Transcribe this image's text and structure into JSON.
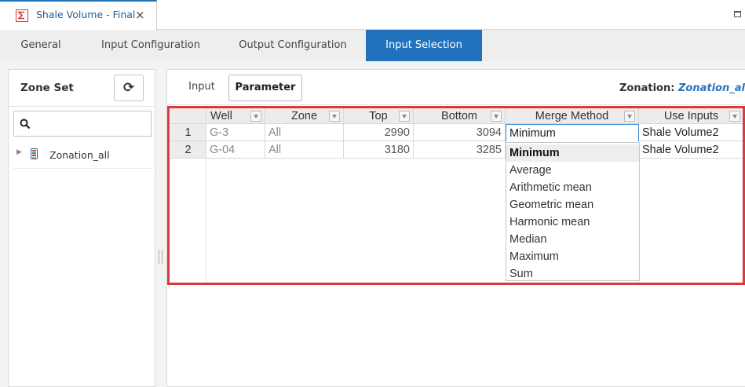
{
  "document_tab": {
    "title": "Shale Volume - Final",
    "close": "×"
  },
  "config_tabs": [
    "General",
    "Input Configuration",
    "Output Configuration",
    "Input Selection"
  ],
  "zone_set": {
    "title": "Zone Set",
    "refresh_glyph": "⟳",
    "search_value": "",
    "tree": [
      {
        "label": "Zonation_all"
      }
    ]
  },
  "inner_tabs": [
    "Input",
    "Parameter"
  ],
  "zonation": {
    "label": "Zonation:",
    "value": "Zonation_all"
  },
  "grid": {
    "columns": [
      "Well",
      "Zone",
      "Top",
      "Bottom",
      "Merge Method",
      "Use Inputs"
    ],
    "rows": [
      {
        "num": "1",
        "well": "G-3",
        "zone": "All",
        "top": "2990",
        "bottom": "3094",
        "merge": "Minimum",
        "inputs": "Shale Volume2"
      },
      {
        "num": "2",
        "well": "G-04",
        "zone": "All",
        "top": "3180",
        "bottom": "3285",
        "merge": "",
        "inputs": "Shale Volume2"
      }
    ]
  },
  "merge_options": [
    "Minimum",
    "Average",
    "Arithmetic mean",
    "Geometric mean",
    "Harmonic mean",
    "Median",
    "Maximum",
    "Sum"
  ],
  "selected_merge_option": "Minimum",
  "colors": {
    "accent": "#1f72bb",
    "highlight": "#e0373a",
    "zonation_link": "#2e73bd"
  }
}
